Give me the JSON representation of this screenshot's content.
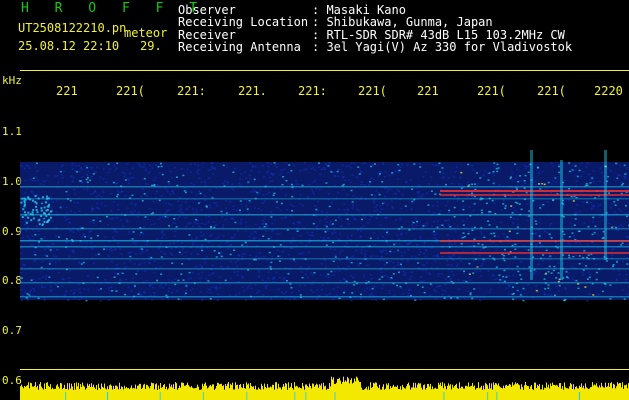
{
  "header": {
    "app_name": "H R O F F T",
    "filename": "UT2508122210.pn",
    "mode": "meteor",
    "datetime": "25.08.12 22:10",
    "counter": "29.",
    "labels": {
      "observer": "Observer",
      "location": "Receiving Location",
      "receiver": "Receiver",
      "antenna": "Receiving Antenna"
    },
    "values": {
      "observer": ": Masaki Kano",
      "location": ": Shibukawa, Gunma, Japan",
      "receiver": ": RTL-SDR SDR# 43dB L15 103.2MHz CW",
      "antenna": ": 3el Yagi(V) Az 330 for Vladivostok"
    }
  },
  "axis": {
    "unit": "kHz",
    "time_ticks": [
      "221",
      "221(",
      "221:",
      "221.",
      "221:",
      "221(",
      "221",
      "221(",
      "221(",
      "2220"
    ],
    "freq_ticks": [
      "1.1",
      "1.0",
      "0.9",
      "0.8",
      "0.7",
      "0.6"
    ]
  },
  "colors": {
    "background": "#000000",
    "axis": "#f2f230",
    "title": "#17c917",
    "text": "#ffffff",
    "signal_low": "#1030c0",
    "signal_mid": "#20d0f0",
    "signal_high": "#f03030",
    "amplitude": "#f2e800"
  }
}
